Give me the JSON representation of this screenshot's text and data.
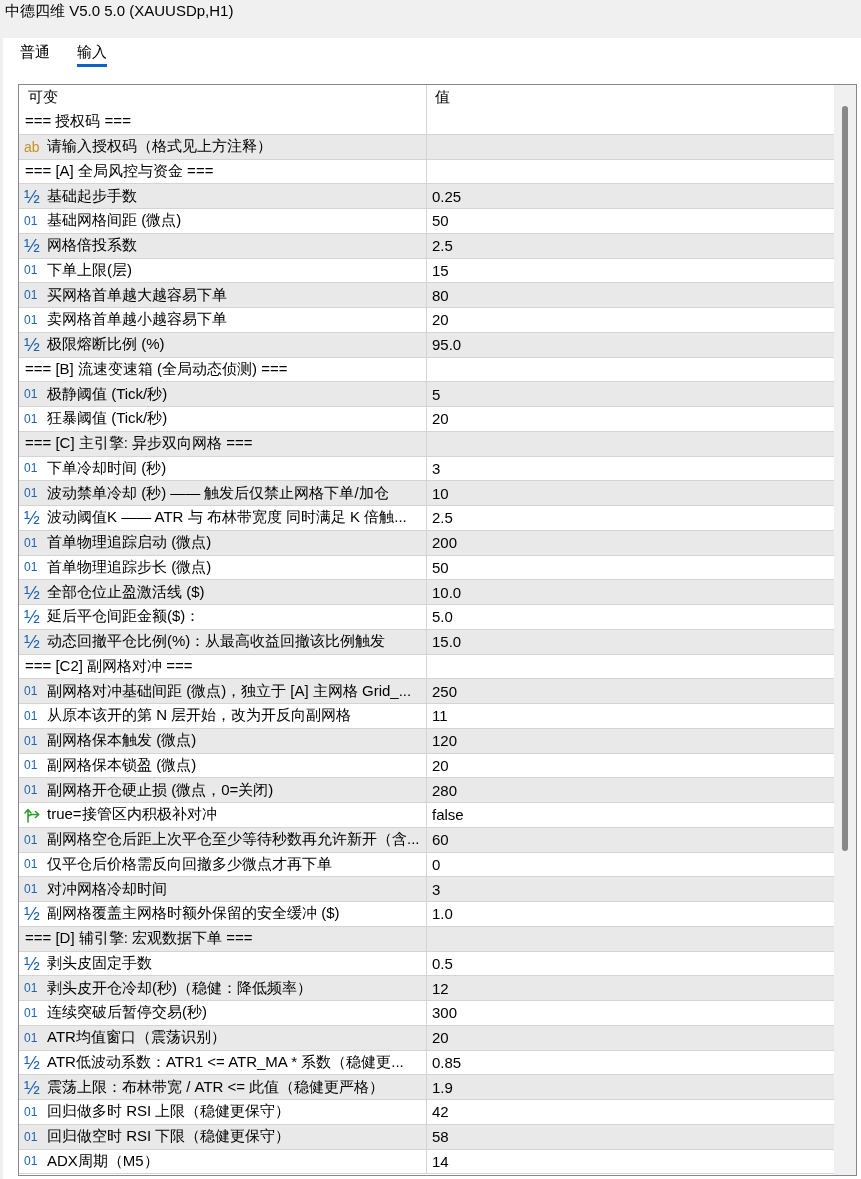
{
  "window": {
    "title": "中德四维 V5.0 5.0 (XAUUSDp,H1)"
  },
  "tabs": [
    {
      "label": "普通",
      "selected": false
    },
    {
      "label": "输入",
      "selected": true
    }
  ],
  "table": {
    "columns": [
      "可变",
      "值"
    ],
    "rows": [
      {
        "kind": "section",
        "label": "=== 授权码 ==="
      },
      {
        "kind": "string",
        "icon": "ab",
        "label": "请输入授权码（格式见上方注释）"
      },
      {
        "kind": "section",
        "label": "=== [A] 全局风控与资金 ==="
      },
      {
        "kind": "double",
        "icon": "½",
        "label": "基础起步手数",
        "value": "0.25"
      },
      {
        "kind": "int",
        "icon": "01",
        "label": "基础网格间距 (微点)",
        "value": "50"
      },
      {
        "kind": "double",
        "icon": "½",
        "label": "网格倍投系数",
        "value": "2.5"
      },
      {
        "kind": "int",
        "icon": "01",
        "label": "下单上限(层)",
        "value": "15"
      },
      {
        "kind": "int",
        "icon": "01",
        "label": "买网格首单越大越容易下单",
        "value": "80"
      },
      {
        "kind": "int",
        "icon": "01",
        "label": "卖网格首单越小越容易下单",
        "value": "20"
      },
      {
        "kind": "double",
        "icon": "½",
        "label": "极限熔断比例 (%)",
        "value": "95.0"
      },
      {
        "kind": "section",
        "label": "=== [B] 流速变速箱 (全局动态侦测) ==="
      },
      {
        "kind": "int",
        "icon": "01",
        "label": "极静阈值 (Tick/秒)",
        "value": "5"
      },
      {
        "kind": "int",
        "icon": "01",
        "label": "狂暴阈值 (Tick/秒)",
        "value": "20"
      },
      {
        "kind": "section",
        "label": "=== [C] 主引擎: 异步双向网格 ==="
      },
      {
        "kind": "int",
        "icon": "01",
        "label": "下单冷却时间 (秒)",
        "value": "3"
      },
      {
        "kind": "int",
        "icon": "01",
        "label": "波动禁单冷却 (秒) —— 触发后仅禁止网格下单/加仓",
        "value": "10"
      },
      {
        "kind": "double",
        "icon": "½",
        "label": "波动阈值K —— ATR 与 布林带宽度 同时满足 K 倍触...",
        "value": "2.5"
      },
      {
        "kind": "int",
        "icon": "01",
        "label": "首单物理追踪启动 (微点)",
        "value": "200"
      },
      {
        "kind": "int",
        "icon": "01",
        "label": "首单物理追踪步长 (微点)",
        "value": "50"
      },
      {
        "kind": "double",
        "icon": "½",
        "label": "全部仓位止盈激活线 ($)",
        "value": "10.0"
      },
      {
        "kind": "double",
        "icon": "½",
        "label": "延后平仓间距金额($)：",
        "value": "5.0"
      },
      {
        "kind": "double",
        "icon": "½",
        "label": "动态回撤平仓比例(%)：从最高收益回撤该比例触发",
        "value": "15.0"
      },
      {
        "kind": "section",
        "label": "=== [C2] 副网格对冲 ==="
      },
      {
        "kind": "int",
        "icon": "01",
        "label": "副网格对冲基础间距 (微点)，独立于 [A] 主网格 Grid_...",
        "value": "250"
      },
      {
        "kind": "int",
        "icon": "01",
        "label": "从原本该开的第 N 层开始，改为开反向副网格",
        "value": "11"
      },
      {
        "kind": "int",
        "icon": "01",
        "label": "副网格保本触发 (微点)",
        "value": "120"
      },
      {
        "kind": "int",
        "icon": "01",
        "label": "副网格保本锁盈 (微点)",
        "value": "20"
      },
      {
        "kind": "int",
        "icon": "01",
        "label": "副网格开仓硬止损 (微点，0=关闭)",
        "value": "280"
      },
      {
        "kind": "bool",
        "label": "true=接管区内积极补对冲",
        "value": "false"
      },
      {
        "kind": "int",
        "icon": "01",
        "label": "副网格空仓后距上次平仓至少等待秒数再允许新开（含...",
        "value": "60"
      },
      {
        "kind": "int",
        "icon": "01",
        "label": "仅平仓后价格需反向回撤多少微点才再下单",
        "value": "0"
      },
      {
        "kind": "int",
        "icon": "01",
        "label": "对冲网格冷却时间",
        "value": "3"
      },
      {
        "kind": "double",
        "icon": "½",
        "label": "副网格覆盖主网格时额外保留的安全缓冲 ($)",
        "value": "1.0"
      },
      {
        "kind": "section",
        "label": "=== [D] 辅引擎: 宏观数据下单 ==="
      },
      {
        "kind": "double",
        "icon": "½",
        "label": "剥头皮固定手数",
        "value": "0.5"
      },
      {
        "kind": "int",
        "icon": "01",
        "label": "剥头皮开仓冷却(秒)（稳健：降低频率）",
        "value": "12"
      },
      {
        "kind": "int",
        "icon": "01",
        "label": "连续突破后暂停交易(秒)",
        "value": "300"
      },
      {
        "kind": "int",
        "icon": "01",
        "label": "ATR均值窗口（震荡识别）",
        "value": "20"
      },
      {
        "kind": "double",
        "icon": "½",
        "label": "ATR低波动系数：ATR1 <= ATR_MA * 系数（稳健更...",
        "value": "0.85"
      },
      {
        "kind": "double",
        "icon": "½",
        "label": "震荡上限：布林带宽 / ATR <= 此值（稳健更严格）",
        "value": "1.9"
      },
      {
        "kind": "int",
        "icon": "01",
        "label": "回归做多时 RSI 上限（稳健更保守）",
        "value": "42"
      },
      {
        "kind": "int",
        "icon": "01",
        "label": "回归做空时 RSI 下限（稳健更保守）",
        "value": "58"
      },
      {
        "kind": "int",
        "icon": "01",
        "label": "ADX周期（M5）",
        "value": "14"
      }
    ]
  }
}
